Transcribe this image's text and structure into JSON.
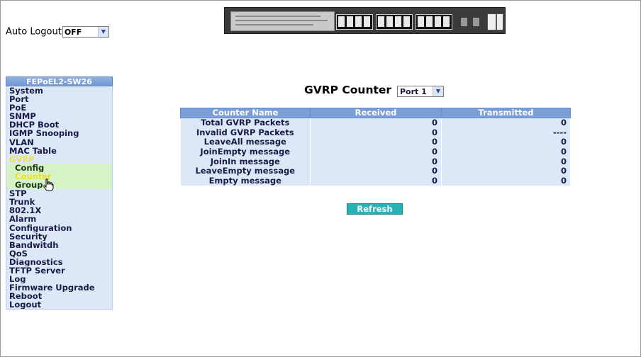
{
  "auto_logout": {
    "label": "Auto Logout",
    "value": "OFF"
  },
  "sidebar": {
    "title": "FEPoEL2-SW26",
    "items": [
      {
        "label": "System"
      },
      {
        "label": "Port"
      },
      {
        "label": "PoE"
      },
      {
        "label": "SNMP"
      },
      {
        "label": "DHCP Boot"
      },
      {
        "label": "IGMP Snooping"
      },
      {
        "label": "VLAN"
      },
      {
        "label": "MAC Table"
      },
      {
        "label": "GVRP"
      },
      {
        "label": "Config"
      },
      {
        "label": "Counter"
      },
      {
        "label": "Group"
      },
      {
        "label": "STP"
      },
      {
        "label": "Trunk"
      },
      {
        "label": "802.1X"
      },
      {
        "label": "Alarm"
      },
      {
        "label": "Configuration"
      },
      {
        "label": "Security"
      },
      {
        "label": "Bandwitdh"
      },
      {
        "label": "QoS"
      },
      {
        "label": "Diagnostics"
      },
      {
        "label": "TFTP Server"
      },
      {
        "label": "Log"
      },
      {
        "label": "Firmware Upgrade"
      },
      {
        "label": "Reboot"
      },
      {
        "label": "Logout"
      }
    ]
  },
  "main": {
    "title": "GVRP Counter",
    "port_select": "Port 1",
    "columns": [
      "Counter Name",
      "Received",
      "Transmitted"
    ],
    "rows": [
      {
        "name": "Total GVRP Packets",
        "received": "0",
        "transmitted": "0"
      },
      {
        "name": "Invalid GVRP Packets",
        "received": "0",
        "transmitted": "----"
      },
      {
        "name": "LeaveAll message",
        "received": "0",
        "transmitted": "0"
      },
      {
        "name": "JoinEmpty message",
        "received": "0",
        "transmitted": "0"
      },
      {
        "name": "JoinIn message",
        "received": "0",
        "transmitted": "0"
      },
      {
        "name": "LeaveEmpty message",
        "received": "0",
        "transmitted": "0"
      },
      {
        "name": "Empty message",
        "received": "0",
        "transmitted": "0"
      }
    ],
    "refresh_label": "Refresh"
  }
}
